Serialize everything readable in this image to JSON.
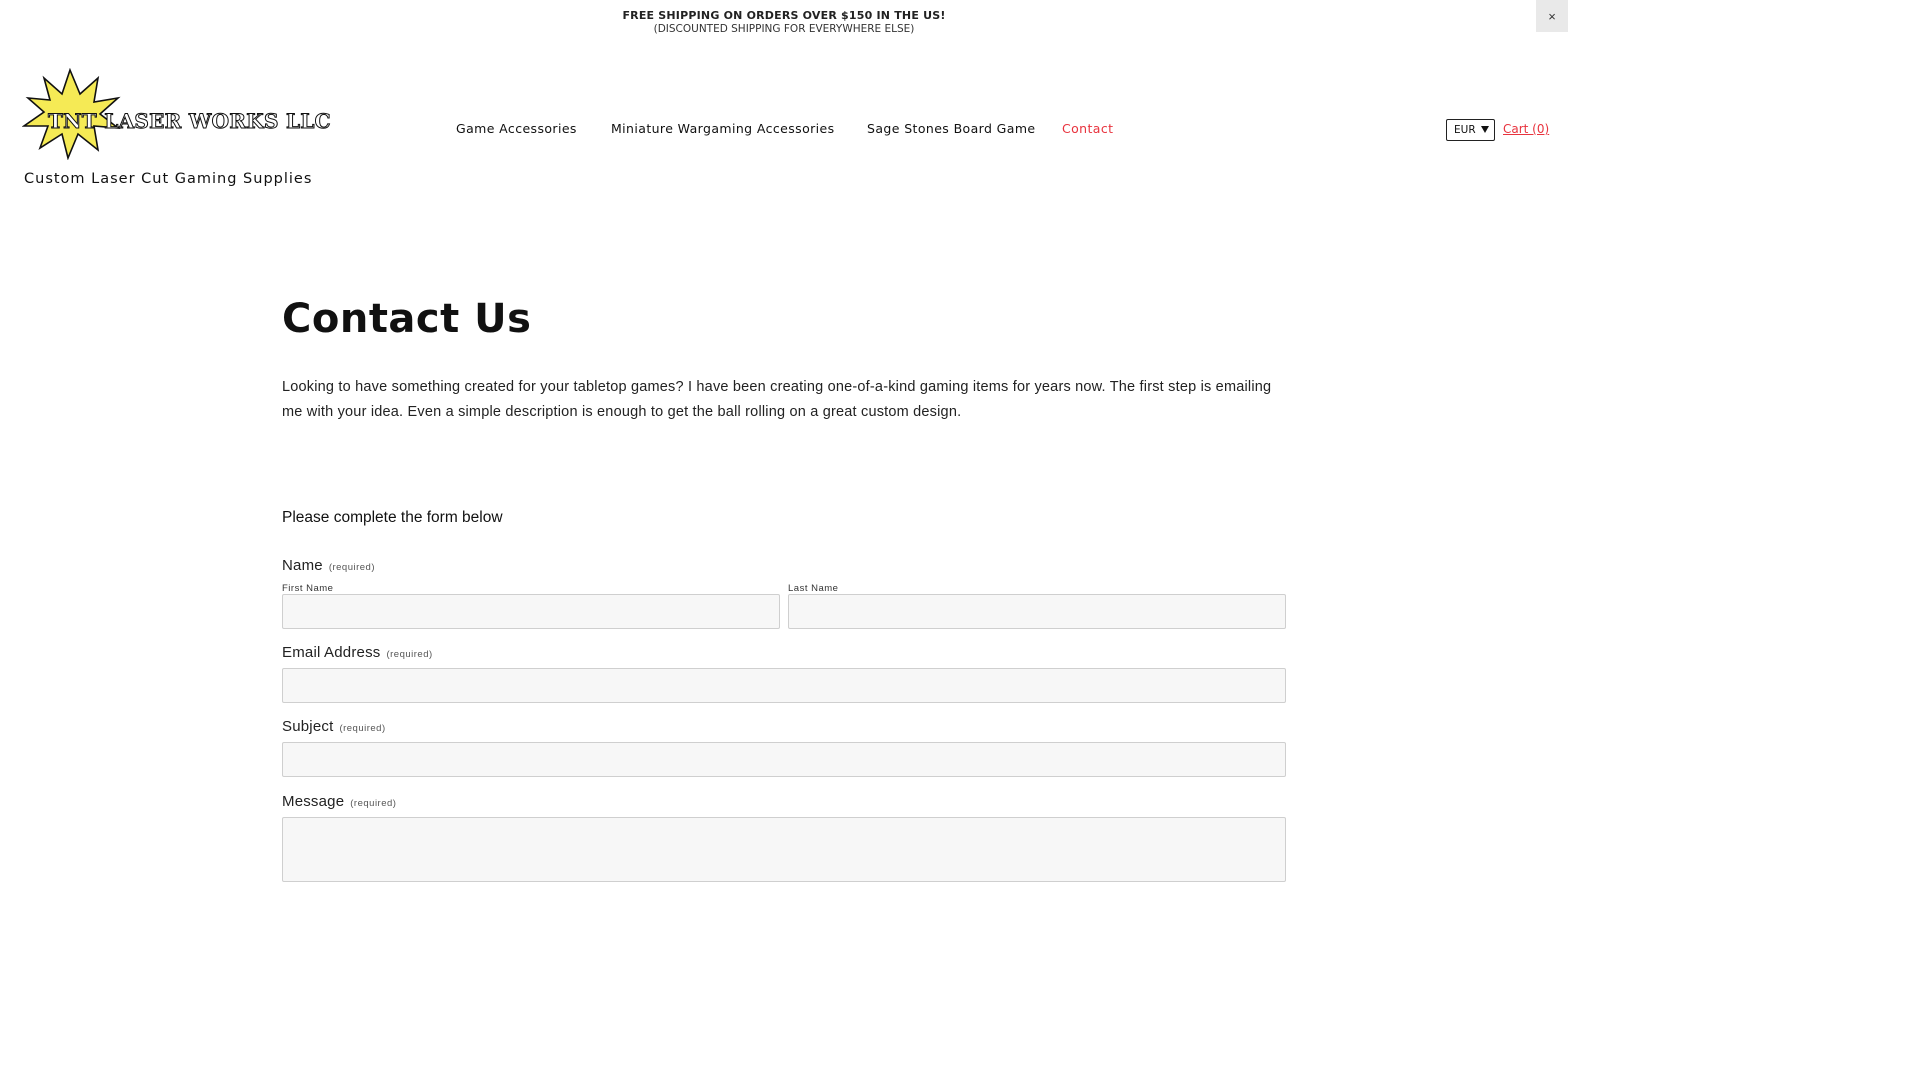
{
  "announcement": {
    "line1": "FREE SHIPPING ON ORDERS OVER $150 IN THE US!",
    "line2": "(DISCOUNTED SHIPPING FOR EVERYWHERE ELSE)",
    "close_icon": "×"
  },
  "brand": {
    "logo_text": "TNT LASER WORKS LLC",
    "tagline": "Custom Laser Cut Gaming Supplies",
    "logo_color": "#f5ea55"
  },
  "nav": {
    "items": [
      {
        "label": "Game Accessories"
      },
      {
        "label": "Miniature Wargaming Accessories"
      },
      {
        "label": "Sage Stones Board Game"
      },
      {
        "label": "Contact"
      }
    ],
    "active": "Contact"
  },
  "header_tools": {
    "currency": "EUR",
    "cart_label": "Cart (0)"
  },
  "page": {
    "title": "Contact Us",
    "intro": "Looking to have something created for your tabletop games? I have been creating one-of-a-kind gaming items for years now. The first step is emailing me with your idea. Even a simple description is enough to get the ball rolling on a great custom design."
  },
  "form": {
    "heading": "Please complete the form below",
    "required_text": "(required)",
    "name_label": "Name",
    "first_name_label": "First Name",
    "last_name_label": "Last Name",
    "email_label": "Email Address",
    "subject_label": "Subject",
    "message_label": "Message",
    "first_name_value": "",
    "last_name_value": "",
    "email_value": "",
    "subject_value": "",
    "message_value": ""
  },
  "colors": {
    "accent": "#e8333e",
    "input_bg": "#f7f7f7",
    "input_border": "#cfcfcf"
  }
}
